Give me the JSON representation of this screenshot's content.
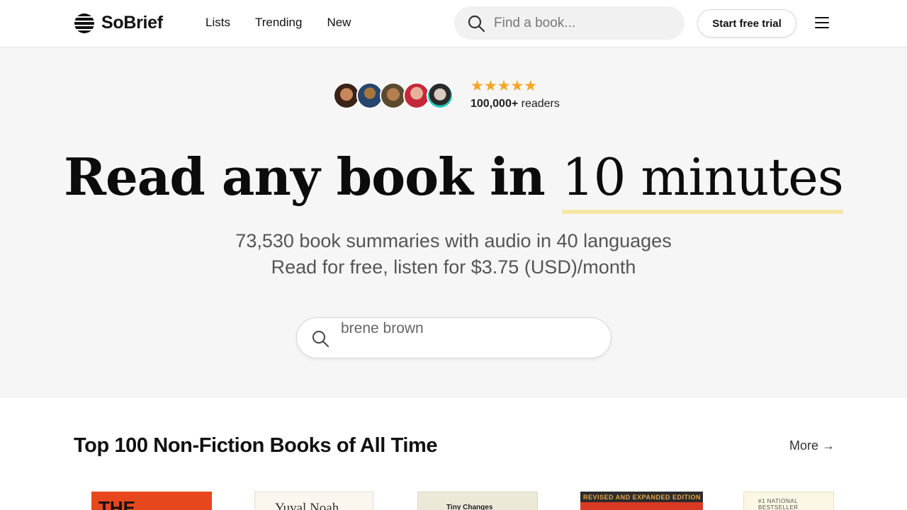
{
  "header": {
    "brand": "SoBrief",
    "nav": [
      "Lists",
      "Trending",
      "New"
    ],
    "search_placeholder": "Find a book...",
    "trial_label": "Start free trial"
  },
  "hero": {
    "stars": "★★★★★",
    "readers_count": "100,000+",
    "readers_label": " readers",
    "headline_main": "Read any book in ",
    "headline_highlight": "10 minutes",
    "sub_line1": "73,530 book summaries with audio in 40 languages",
    "sub_line2": "Read for free, listen for $3.75 (USD)/month",
    "search_value": "brene brown"
  },
  "section": {
    "title": "Top 100 Non-Fiction Books of All Time",
    "more_label": "More →",
    "covers": [
      "THE",
      "Yuval Noah",
      "Tiny Changes",
      "REVISED AND EXPANDED EDITION",
      "#1 NATIONAL BESTSELLER"
    ]
  },
  "colors": {
    "star": "#f5a623",
    "highlight_underline": "#f5e6a6",
    "hero_bg": "#f6f6f6"
  },
  "icons": {
    "logo": "sobrief-logo-icon",
    "search": "search-icon",
    "menu": "hamburger-menu-icon"
  }
}
